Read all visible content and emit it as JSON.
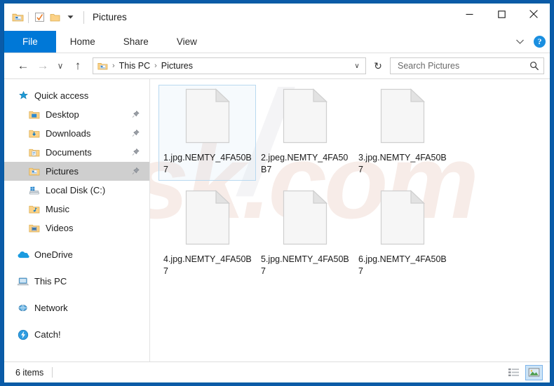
{
  "window": {
    "title": "Pictures",
    "quick_access_toolbar": [
      {
        "name": "explorer-icon",
        "label": "Explorer"
      },
      {
        "name": "properties-icon",
        "label": "Properties"
      },
      {
        "name": "new-folder-icon",
        "label": "New folder"
      },
      {
        "name": "customize-dropdown-icon",
        "label": "Customize Quick Access Toolbar"
      }
    ],
    "controls": {
      "minimize": "—",
      "maximize": "☐",
      "close": "✕"
    }
  },
  "ribbon": {
    "tabs": [
      {
        "label": "File",
        "active": true
      },
      {
        "label": "Home",
        "active": false
      },
      {
        "label": "Share",
        "active": false
      },
      {
        "label": "View",
        "active": false
      }
    ],
    "collapse_icon": "∨",
    "help_label": "?"
  },
  "address": {
    "back": "←",
    "forward": "→",
    "recent": "∨",
    "up": "↑",
    "breadcrumb": [
      "This PC",
      "Pictures"
    ],
    "separator": "›",
    "dropdown": "∨",
    "refresh": "↻"
  },
  "search": {
    "placeholder": "Search Pictures",
    "value": "",
    "icon": "search-icon"
  },
  "sidebar": {
    "groups": [
      {
        "items": [
          {
            "label": "Quick access",
            "icon": "star-icon",
            "indent": false,
            "pinned": false,
            "selected": false
          },
          {
            "label": "Desktop",
            "icon": "desktop-folder-icon",
            "indent": true,
            "pinned": true,
            "selected": false
          },
          {
            "label": "Downloads",
            "icon": "downloads-folder-icon",
            "indent": true,
            "pinned": true,
            "selected": false
          },
          {
            "label": "Documents",
            "icon": "documents-folder-icon",
            "indent": true,
            "pinned": true,
            "selected": false
          },
          {
            "label": "Pictures",
            "icon": "pictures-folder-icon",
            "indent": true,
            "pinned": true,
            "selected": true
          },
          {
            "label": "Local Disk (C:)",
            "icon": "local-disk-icon",
            "indent": true,
            "pinned": false,
            "selected": false
          },
          {
            "label": "Music",
            "icon": "music-folder-icon",
            "indent": true,
            "pinned": false,
            "selected": false
          },
          {
            "label": "Videos",
            "icon": "videos-folder-icon",
            "indent": true,
            "pinned": false,
            "selected": false
          }
        ]
      },
      {
        "items": [
          {
            "label": "OneDrive",
            "icon": "onedrive-icon",
            "indent": false,
            "pinned": false,
            "selected": false
          }
        ]
      },
      {
        "items": [
          {
            "label": "This PC",
            "icon": "this-pc-icon",
            "indent": false,
            "pinned": false,
            "selected": false
          }
        ]
      },
      {
        "items": [
          {
            "label": "Network",
            "icon": "network-icon",
            "indent": false,
            "pinned": false,
            "selected": false
          }
        ]
      },
      {
        "items": [
          {
            "label": "Catch!",
            "icon": "catch-icon",
            "indent": false,
            "pinned": false,
            "selected": false
          }
        ]
      }
    ]
  },
  "files": [
    {
      "name": "1.jpg.NEMTY_4FA50B7",
      "icon": "generic-file-icon",
      "selected": true
    },
    {
      "name": "2.jpeg.NEMTY_4FA50B7",
      "icon": "generic-file-icon",
      "selected": false
    },
    {
      "name": "3.jpg.NEMTY_4FA50B7",
      "icon": "generic-file-icon",
      "selected": false
    },
    {
      "name": "4.jpg.NEMTY_4FA50B7",
      "icon": "generic-file-icon",
      "selected": false
    },
    {
      "name": "5.jpg.NEMTY_4FA50B7",
      "icon": "generic-file-icon",
      "selected": false
    },
    {
      "name": "6.jpg.NEMTY_4FA50B7",
      "icon": "generic-file-icon",
      "selected": false
    }
  ],
  "watermark": {
    "text": "risk.com",
    "text2": "/"
  },
  "statusbar": {
    "item_count": "6 items",
    "views": [
      {
        "name": "details-view-button",
        "label": "Details view",
        "active": false
      },
      {
        "name": "large-icons-view-button",
        "label": "Large icons view",
        "active": true
      }
    ]
  },
  "colors": {
    "accent": "#0078d7",
    "window_border": "#005a9e",
    "selection": "#cce4f7",
    "selection_border": "#7eb4ea",
    "sidebar_selected": "#cfcfcf"
  }
}
